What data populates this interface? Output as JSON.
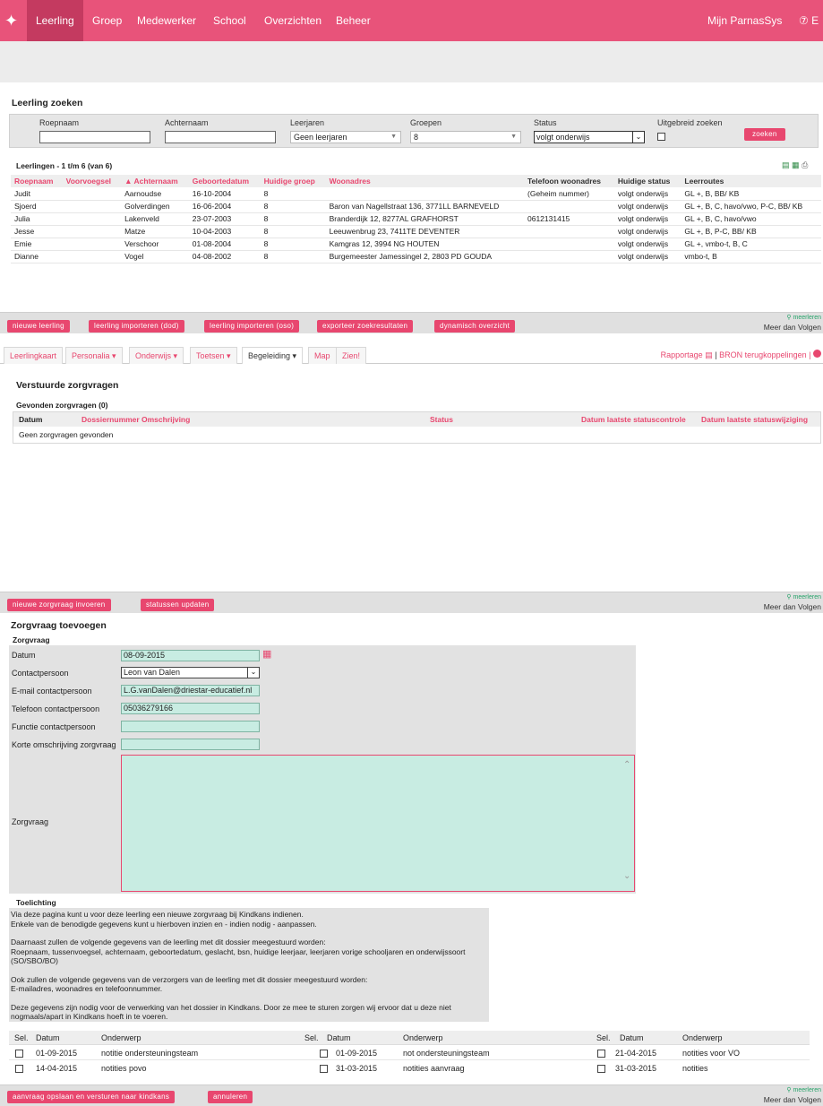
{
  "topnav": {
    "items": [
      "Leerling",
      "Groep",
      "Medewerker",
      "School",
      "Overzichten",
      "Beheer"
    ],
    "right_label": "Mijn ParnasSys",
    "right_extra": "⑦ E"
  },
  "search": {
    "title": "Leerling zoeken",
    "roepnaam_label": "Roepnaam",
    "achternaam_label": "Achternaam",
    "leerjaren_label": "Leerjaren",
    "leerjaren_value": "Geen leerjaren",
    "groepen_label": "Groepen",
    "groepen_value": "8",
    "status_label": "Status",
    "status_value": "volgt onderwijs",
    "uitgebreid_label": "Uitgebreid zoeken",
    "zoeken_button": "zoeken"
  },
  "results": {
    "title": "Leerlingen - 1 t/m 6 (van 6)",
    "columns": [
      "Roepnaam",
      "Voorvoegsel",
      "▲ Achternaam",
      "Geboortedatum",
      "Huidige groep",
      "Woonadres",
      "Telefoon woonadres",
      "Huidige status",
      "Leerroutes"
    ],
    "rows": [
      [
        "Judit",
        "",
        "Aarnoudse",
        "16-10-2004",
        "8",
        "",
        "(Geheim nummer)",
        "volgt onderwijs",
        "GL +, B, BB/ KB"
      ],
      [
        "Sjoerd",
        "",
        "Golverdingen",
        "16-06-2004",
        "8",
        "Baron van Nagellstraat 136, 3771LL BARNEVELD",
        "",
        "volgt onderwijs",
        "GL +, B, C, havo/vwo, P-C, BB/ KB"
      ],
      [
        "Julia",
        "",
        "Lakenveld",
        "23-07-2003",
        "8",
        "Branderdijk 12, 8277AL GRAFHORST",
        "0612131415",
        "volgt onderwijs",
        "GL +, B, C, havo/vwo"
      ],
      [
        "Jesse",
        "",
        "Matze",
        "10-04-2003",
        "8",
        "Leeuwenbrug 23, 7411TE DEVENTER",
        "",
        "volgt onderwijs",
        "GL +, B, P-C, BB/ KB"
      ],
      [
        "Emie",
        "",
        "Verschoor",
        "01-08-2004",
        "8",
        "Kamgras 12, 3994 NG HOUTEN",
        "",
        "volgt onderwijs",
        "GL +, vmbo-t, B, C"
      ],
      [
        "Dianne",
        "",
        "Vogel",
        "04-08-2002",
        "8",
        "Burgemeester Jamessingel 2, 2803 PD GOUDA",
        "",
        "volgt onderwijs",
        "vmbo-t, B"
      ]
    ]
  },
  "actions1": {
    "buttons": [
      "nieuwe leerling",
      "leerling importeren (dod)",
      "leerling importeren (oso)",
      "exporteer zoekresultaten",
      "dynamisch overzicht"
    ],
    "meer_icon_label": "meerleren",
    "meer_label": "Meer dan Volgen"
  },
  "tabs": {
    "items": [
      "Leerlingkaart",
      "Personalia ▾",
      "Onderwijs ▾",
      "Toetsen ▾",
      "Begeleiding ▾",
      "Map",
      "Zien!"
    ],
    "rapportage": "Rapportage",
    "bron": "BRON terugkoppelingen |"
  },
  "zorgvragen": {
    "title": "Verstuurde zorgvragen",
    "found_label": "Gevonden zorgvragen (0)",
    "columns": [
      "Datum",
      "Dossiernummer",
      "Omschrijving",
      "Status",
      "Datum laatste statuscontrole",
      "Datum laatste statuswijziging"
    ],
    "empty": "Geen zorgvragen gevonden"
  },
  "actions2": {
    "buttons": [
      "nieuwe zorgvraag invoeren",
      "statussen updaten"
    ],
    "meer_icon_label": "meerleren",
    "meer_label": "Meer dan Volgen"
  },
  "form": {
    "title": "Zorgvraag toevoegen",
    "subtitle": "Zorgvraag",
    "datum_label": "Datum",
    "datum_value": "08-09-2015",
    "contact_label": "Contactpersoon",
    "contact_value": "Leon van Dalen",
    "email_label": "E-mail contactpersoon",
    "email_value": "L.G.vanDalen@driestar-educatief.nl",
    "tel_label": "Telefoon contactpersoon",
    "tel_value": "05036279166",
    "functie_label": "Functie contactpersoon",
    "functie_value": "",
    "korte_label": "Korte omschrijving zorgvraag",
    "korte_value": "",
    "zorgvraag_label": "Zorgvraag",
    "zorgvraag_value": ""
  },
  "toelichting": {
    "title": "Toelichting",
    "p1": "Via deze pagina kunt u voor deze leerling een nieuwe zorgvraag bij Kindkans indienen.",
    "p2": "Enkele van de benodigde gegevens kunt u hierboven inzien en - indien nodig - aanpassen.",
    "p3": "Daarnaast zullen de volgende gegevens van de leerling met dit dossier meegestuurd worden:",
    "p4": "Roepnaam, tussenvoegsel, achternaam, geboortedatum, geslacht, bsn, huidige leerjaar, leerjaren vorige schooljaren en onderwijssoort (SO/SBO/BO)",
    "p5": "Ook zullen de volgende gegevens van de verzorgers van de leerling met dit dossier meegestuurd worden:",
    "p6": "E-mailadres, woonadres en telefoonnummer.",
    "p7": "Deze gegevens zijn nodig voor de verwerking van het dossier in Kindkans. Door ze mee te sturen zorgen wij ervoor dat u deze niet nogmaals/apart in Kindkans hoeft in te voeren."
  },
  "notes": {
    "headers": [
      "Sel.",
      "Datum",
      "Onderwerp"
    ],
    "col1": [
      [
        "01-09-2015",
        "notitie ondersteuningsteam"
      ],
      [
        "14-04-2015",
        "notities povo"
      ]
    ],
    "col2": [
      [
        "01-09-2015",
        "not ondersteuningsteam"
      ],
      [
        "31-03-2015",
        "notities aanvraag"
      ]
    ],
    "col3": [
      [
        "21-04-2015",
        "notities voor VO"
      ],
      [
        "31-03-2015",
        "notities"
      ]
    ]
  },
  "actions3": {
    "buttons": [
      "aanvraag opslaan en versturen naar kindkans",
      "annuleren"
    ],
    "meer_icon_label": "meerleren",
    "meer_label": "Meer dan Volgen"
  }
}
